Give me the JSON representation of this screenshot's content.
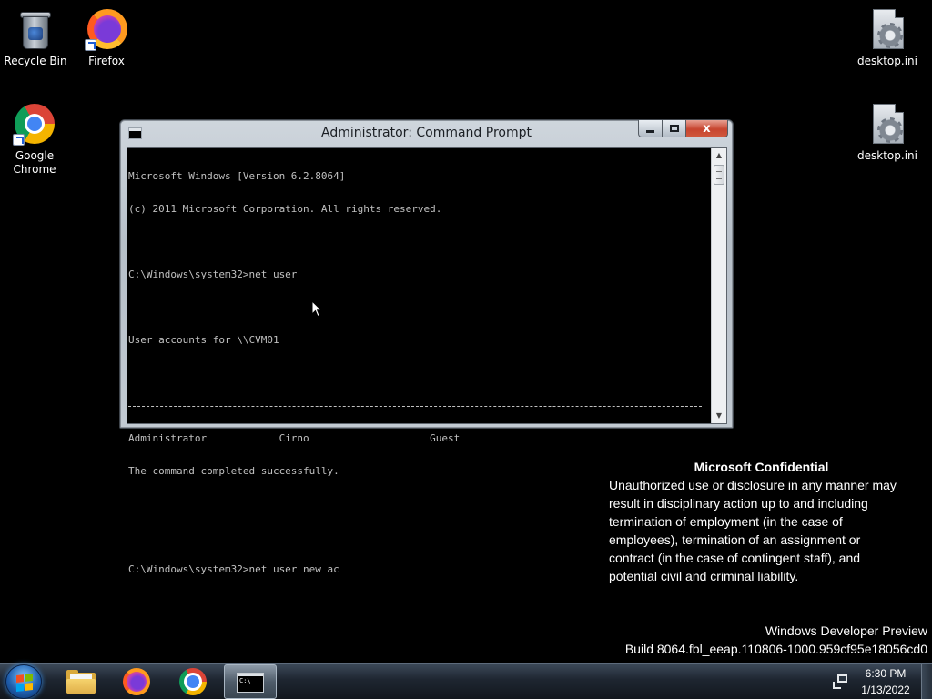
{
  "desktop": {
    "icons": [
      {
        "label": "Recycle Bin",
        "icon": "recycle-bin-icon"
      },
      {
        "label": "Firefox",
        "icon": "firefox-icon"
      },
      {
        "label": "Google Chrome",
        "icon": "chrome-icon"
      },
      {
        "label": "desktop.ini",
        "icon": "settings-file-icon"
      },
      {
        "label": "desktop.ini",
        "icon": "settings-file-icon"
      }
    ]
  },
  "window": {
    "title": "Administrator: Command Prompt",
    "close_glyph": "x",
    "console_lines": [
      "Microsoft Windows [Version 6.2.8064]",
      "(c) 2011 Microsoft Corporation. All rights reserved.",
      "",
      "C:\\Windows\\system32>net user",
      "",
      "User accounts for \\\\CVM01",
      "",
      "Administrator            Cirno                    Guest",
      "The command completed successfully.",
      "",
      "",
      "C:\\Windows\\system32>net user new ac"
    ]
  },
  "notice": {
    "title": "Microsoft Confidential",
    "lines": [
      "Unauthorized use or disclosure in any manner may",
      "result in disciplinary action up to and including",
      "termination of employment (in the case of",
      "employees), termination of an assignment or",
      "contract (in the case of contingent staff), and",
      "potential civil and criminal liability."
    ]
  },
  "build": {
    "line1": "Windows Developer Preview",
    "line2": "Build 8064.fbl_eeap.110806-1000.959cf95e18056cd0"
  },
  "taskbar": {
    "cmd_icon_text": "C:\\_",
    "clock_time": "6:30 PM",
    "clock_date": "1/13/2022"
  },
  "colors": {
    "desktop_bg": "#000000",
    "console_text": "#c0c0c0",
    "close_button": "#c7452f"
  }
}
